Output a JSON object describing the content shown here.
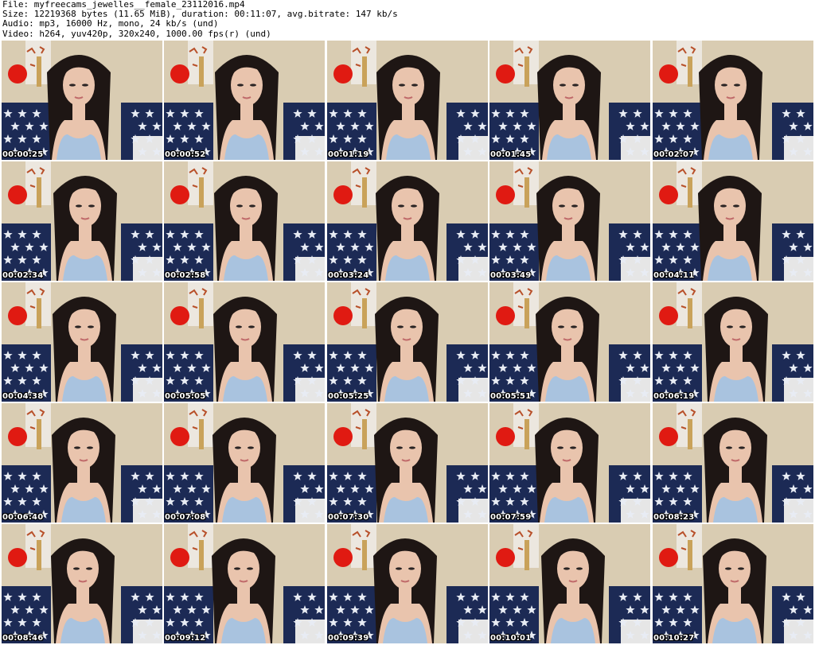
{
  "header": {
    "file": "File: myfreecams_jewelles__female_23112016.mp4",
    "size": "Size: 12219368 bytes (11.65 MiB), duration: 00:11:07, avg.bitrate: 147 kb/s",
    "audio": "Audio: mp3, 16000 Hz, mono, 24 kb/s (und)",
    "video": "Video: h264, yuv420p, 320x240, 1000.00 fps(r) (und)"
  },
  "thumbnails": [
    {
      "timestamp": "00:00:25"
    },
    {
      "timestamp": "00:00:52"
    },
    {
      "timestamp": "00:01:19"
    },
    {
      "timestamp": "00:01:45"
    },
    {
      "timestamp": "00:02:07"
    },
    {
      "timestamp": "00:02:34"
    },
    {
      "timestamp": "00:02:58"
    },
    {
      "timestamp": "00:03:24"
    },
    {
      "timestamp": "00:03:49"
    },
    {
      "timestamp": "00:04:11"
    },
    {
      "timestamp": "00:04:38"
    },
    {
      "timestamp": "00:05:05"
    },
    {
      "timestamp": "00:05:25"
    },
    {
      "timestamp": "00:05:51"
    },
    {
      "timestamp": "00:06:19"
    },
    {
      "timestamp": "00:06:40"
    },
    {
      "timestamp": "00:07:08"
    },
    {
      "timestamp": "00:07:30"
    },
    {
      "timestamp": "00:07:59"
    },
    {
      "timestamp": "00:08:23"
    },
    {
      "timestamp": "00:08:46"
    },
    {
      "timestamp": "00:09:12"
    },
    {
      "timestamp": "00:09:39"
    },
    {
      "timestamp": "00:10:01"
    },
    {
      "timestamp": "00:10:27"
    }
  ],
  "colors": {
    "wall": "#d9ccb2",
    "couch": "#1c2a55",
    "star": "#e8ecf4",
    "hair": "#1e1614",
    "skin": "#e9c4ad",
    "top": "#a9c3df",
    "balloon": "#e01a12"
  }
}
